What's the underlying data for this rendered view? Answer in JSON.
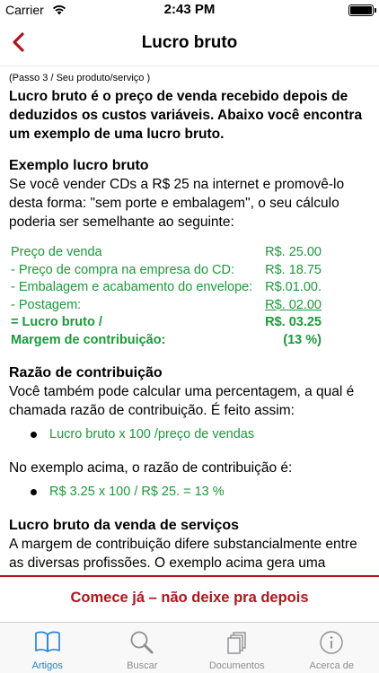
{
  "status_bar": {
    "carrier": "Carrier",
    "time": "2:43 PM"
  },
  "nav": {
    "title": "Lucro bruto"
  },
  "content": {
    "step": "(Passo 3 / Seu produto/serviço )",
    "intro": "Lucro bruto é o preço de venda recebido depois de deduzidos os custos variáveis. Abaixo você encontra um exemplo de uma lucro bruto.",
    "example_heading": "Exemplo lucro bruto",
    "example_text": "Se você vender CDs a R$ 25 na internet e promovê-lo desta forma: \"sem porte e embalagem\", o seu cálculo poderia ser semelhante ao seguinte:",
    "table": [
      {
        "label": "Preço de venda",
        "value": "R$. 25.00"
      },
      {
        "label": "- Preço de compra na empresa do CD:",
        "value": "R$. 18.75"
      },
      {
        "label": "- Embalagem e acabamento do envelope:",
        "value": "R$.01.00."
      },
      {
        "label": "- Postagem:",
        "value": "R$. 02.00"
      },
      {
        "label": "= Lucro bruto /",
        "value": "R$. 03.25"
      },
      {
        "label": "Margem de contribuição:",
        "value": "(13 %)"
      }
    ],
    "ratio_heading": "Razão de contribuição",
    "ratio_text": "Você também pode calcular uma percentagem, a qual é chamada razão de contribuição. É feito assim:",
    "ratio_bullet": "Lucro bruto x 100 /preço de vendas",
    "example_ratio_text": "No exemplo acima, o razão de contribuição é:",
    "example_ratio_bullet": "R$ 3.25 x 100 / R$ 25. = 13 %",
    "services_heading": "Lucro bruto da venda de serviços",
    "services_text": "A margem de contribuição difere substancialmente entre as diversas profissões. O exemplo acima gera uma margem relativamente modesta de contribuição"
  },
  "banner": {
    "text": "Comece já – não deixe pra depois",
    "color": "#b0141e"
  },
  "tabs": [
    {
      "label": "Artigos",
      "icon": "book-icon",
      "active": true
    },
    {
      "label": "Buscar",
      "icon": "search-icon",
      "active": false
    },
    {
      "label": "Documentos",
      "icon": "documents-icon",
      "active": false
    },
    {
      "label": "Acerca de",
      "icon": "info-icon",
      "active": false
    }
  ],
  "colors": {
    "accent": "#b0141e",
    "green": "#1a9a3a",
    "tab_active": "#1d7fd6"
  }
}
